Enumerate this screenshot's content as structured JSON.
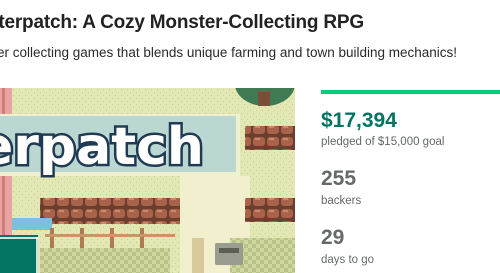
{
  "project": {
    "title": "sterpatch: A Cozy Monster-Collecting RPG",
    "blurb": "er collecting games that blends unique farming and town building mechanics!"
  },
  "hero_image": {
    "logo_text": "erpatch"
  },
  "stats": {
    "pledged_amount": "$17,394",
    "pledged_label": "pledged of $15,000 goal",
    "backers_count": "255",
    "backers_label": "backers",
    "days_count": "29",
    "days_label": "days to go",
    "funding_progress_fraction": 1.0,
    "accent_color": "#05ce78",
    "amount_color": "#037362"
  }
}
